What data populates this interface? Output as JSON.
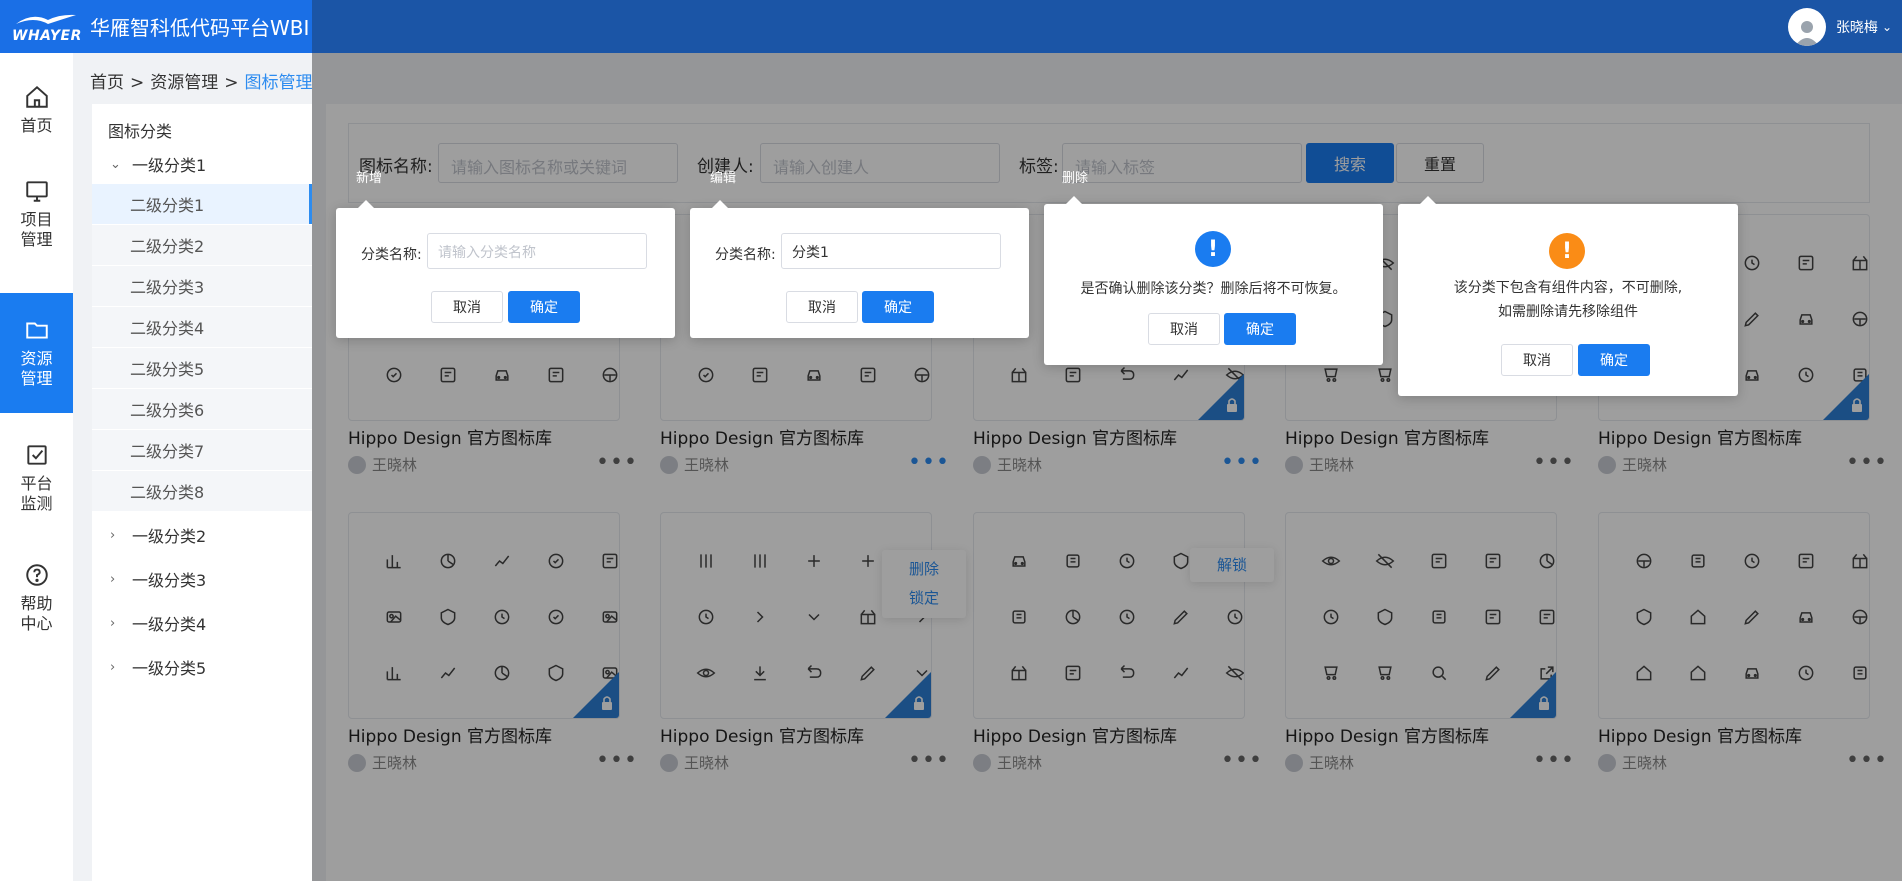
{
  "header": {
    "logo_text": "WHAYER",
    "app_title": "华雁智科低代码平台WBI",
    "user_name": "张晓梅"
  },
  "sidenav": {
    "items": [
      {
        "label": "首页",
        "icon": "home-icon"
      },
      {
        "label": "项目\n管理",
        "icon": "monitor-icon"
      },
      {
        "label": "资源\n管理",
        "icon": "folder-icon",
        "active": true
      },
      {
        "label": "平台\n监测",
        "icon": "checkbox-icon"
      },
      {
        "label": "帮助\n中心",
        "icon": "help-icon"
      }
    ]
  },
  "breadcrumb": {
    "home": "首页",
    "sep1": ">",
    "parent": "资源管理",
    "sep2": ">",
    "current": "图标管理"
  },
  "tree": {
    "heading": "图标分类",
    "level1": [
      "一级分类1",
      "一级分类2",
      "一级分类3",
      "一级分类4",
      "一级分类5"
    ],
    "level2": [
      "二级分类1",
      "二级分类2",
      "二级分类3",
      "二级分类4",
      "二级分类5",
      "二级分类6",
      "二级分类7",
      "二级分类8"
    ]
  },
  "filter": {
    "name_label": "图标名称:",
    "name_placeholder": "请输入图标名称或关键词",
    "creator_label": "创建人:",
    "creator_placeholder": "请输入创建人",
    "tag_label": "标签:",
    "tag_placeholder": "请输入标签",
    "search": "搜索",
    "reset": "重置"
  },
  "card": {
    "title": "Hippo Design 官方图标库",
    "author": "王晓林",
    "more": "•••"
  },
  "menus": {
    "delete": "删除",
    "lock": "锁定",
    "unlock": "解锁"
  },
  "popovers": {
    "add": {
      "caption": "新增",
      "label": "分类名称:",
      "placeholder": "请输入分类名称",
      "cancel": "取消",
      "confirm": "确定"
    },
    "edit": {
      "caption": "编辑",
      "label": "分类名称:",
      "value": "分类1",
      "cancel": "取消",
      "confirm": "确定"
    },
    "delete": {
      "caption": "删除",
      "icon_text": "!",
      "message": "是否确认删除该分类？删除后将不可恢复。",
      "cancel": "取消",
      "confirm": "确定",
      "color": "#1a7cf0"
    },
    "cannot_delete": {
      "icon_text": "!",
      "message_line1": "该分类下包含有组件内容，不可删除,",
      "message_line2": "如需删除请先移除组件",
      "cancel": "取消",
      "confirm": "确定",
      "color": "#fa8c16"
    }
  },
  "colors": {
    "primary": "#1a7cf0",
    "header": "#1b55a6",
    "warning": "#fa8c16"
  }
}
